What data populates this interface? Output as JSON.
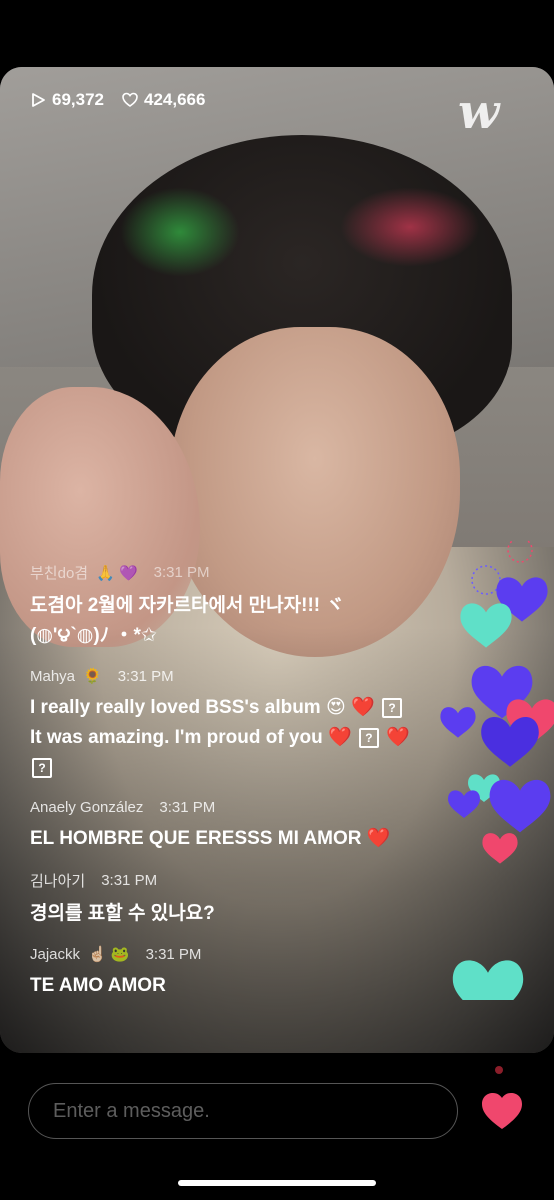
{
  "stats": {
    "views": "69,372",
    "likes": "424,666"
  },
  "logo": "w",
  "chat": [
    {
      "user": "부친do겸",
      "badges": "🙏 💜",
      "time": "3:31 PM",
      "text": "도겸아 2월에 자카르타에서 만나자!!! ヾ(◍'౪`◍)ﾉ ・*✩",
      "dim": true
    },
    {
      "user": "Mahya",
      "badges": "🌻",
      "time": "3:31 PM",
      "text": "I really really loved BSS's album 😍 ❤️",
      "text2": " It was amazing. I'm proud of you ❤️",
      "text3": "❤️"
    },
    {
      "user": "Anaely González",
      "badges": "",
      "time": "3:31 PM",
      "text": "EL HOMBRE QUE ERESSS MI AMOR ❤️"
    },
    {
      "user": "김나아기",
      "badges": "",
      "time": "3:31 PM",
      "text": "경의를 표할 수 있나요?"
    },
    {
      "user": "Jajackk",
      "badges": "☝🏻 🐸",
      "time": "3:31 PM",
      "text": "TE AMO AMOR"
    }
  ],
  "input": {
    "placeholder": "Enter a message."
  },
  "colors": {
    "like": "#f0476d",
    "purple": "#5b3df0",
    "teal": "#5fe0c8"
  }
}
